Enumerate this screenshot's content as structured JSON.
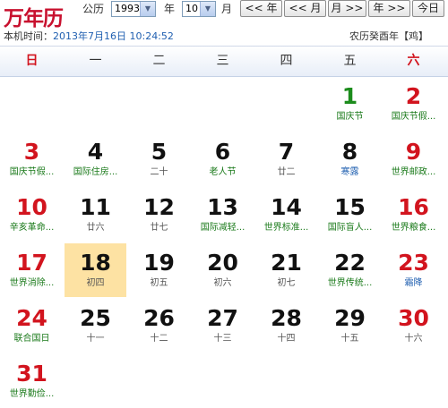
{
  "header": {
    "logo": "万年历",
    "gregorian_label": "公历",
    "year": "1993",
    "year_label": "年",
    "month": "10",
    "month_label": "月",
    "buttons": {
      "prev_year": "<< 年",
      "prev_month": "<< 月",
      "next_month": "月 >>",
      "next_year": "年 >>",
      "today": "今日"
    },
    "local_time_label": "本机时间：",
    "local_time": "2013年7月16日 10:24:52",
    "lunar_year": "农历癸酉年【鸡】"
  },
  "weekdays": [
    "日",
    "一",
    "二",
    "三",
    "四",
    "五",
    "六"
  ],
  "colors": {
    "red": "#d2141e",
    "green": "#1c8c1c",
    "blue": "#1f5fb0",
    "today_bg": "#fde2a3"
  },
  "days": [
    {
      "day": "1",
      "sub": "国庆节",
      "col": 5,
      "row": 0,
      "dc": "green",
      "sc": "green"
    },
    {
      "day": "2",
      "sub": "国庆节假...",
      "col": 6,
      "row": 0,
      "dc": "red",
      "sc": "green"
    },
    {
      "day": "3",
      "sub": "国庆节假...",
      "col": 0,
      "row": 1,
      "dc": "red",
      "sc": "green"
    },
    {
      "day": "4",
      "sub": "国际住房...",
      "col": 1,
      "row": 1,
      "dc": "",
      "sc": "green"
    },
    {
      "day": "5",
      "sub": "二十",
      "col": 2,
      "row": 1,
      "dc": "",
      "sc": ""
    },
    {
      "day": "6",
      "sub": "老人节",
      "col": 3,
      "row": 1,
      "dc": "",
      "sc": "green"
    },
    {
      "day": "7",
      "sub": "廿二",
      "col": 4,
      "row": 1,
      "dc": "",
      "sc": ""
    },
    {
      "day": "8",
      "sub": "寒露",
      "col": 5,
      "row": 1,
      "dc": "",
      "sc": "blue"
    },
    {
      "day": "9",
      "sub": "世界邮政...",
      "col": 6,
      "row": 1,
      "dc": "red",
      "sc": "green"
    },
    {
      "day": "10",
      "sub": "辛亥革命...",
      "col": 0,
      "row": 2,
      "dc": "red",
      "sc": "green"
    },
    {
      "day": "11",
      "sub": "廿六",
      "col": 1,
      "row": 2,
      "dc": "",
      "sc": ""
    },
    {
      "day": "12",
      "sub": "廿七",
      "col": 2,
      "row": 2,
      "dc": "",
      "sc": ""
    },
    {
      "day": "13",
      "sub": "国际减轻...",
      "col": 3,
      "row": 2,
      "dc": "",
      "sc": "green"
    },
    {
      "day": "14",
      "sub": "世界标准...",
      "col": 4,
      "row": 2,
      "dc": "",
      "sc": "green"
    },
    {
      "day": "15",
      "sub": "国际盲人...",
      "col": 5,
      "row": 2,
      "dc": "",
      "sc": "green"
    },
    {
      "day": "16",
      "sub": "世界粮食...",
      "col": 6,
      "row": 2,
      "dc": "red",
      "sc": "green"
    },
    {
      "day": "17",
      "sub": "世界消除...",
      "col": 0,
      "row": 3,
      "dc": "red",
      "sc": "green"
    },
    {
      "day": "18",
      "sub": "初四",
      "col": 1,
      "row": 3,
      "dc": "",
      "sc": "",
      "today": true
    },
    {
      "day": "19",
      "sub": "初五",
      "col": 2,
      "row": 3,
      "dc": "",
      "sc": ""
    },
    {
      "day": "20",
      "sub": "初六",
      "col": 3,
      "row": 3,
      "dc": "",
      "sc": ""
    },
    {
      "day": "21",
      "sub": "初七",
      "col": 4,
      "row": 3,
      "dc": "",
      "sc": ""
    },
    {
      "day": "22",
      "sub": "世界传统...",
      "col": 5,
      "row": 3,
      "dc": "",
      "sc": "green"
    },
    {
      "day": "23",
      "sub": "霜降",
      "col": 6,
      "row": 3,
      "dc": "red",
      "sc": "blue"
    },
    {
      "day": "24",
      "sub": "联合国日",
      "col": 0,
      "row": 4,
      "dc": "red",
      "sc": "green"
    },
    {
      "day": "25",
      "sub": "十一",
      "col": 1,
      "row": 4,
      "dc": "",
      "sc": ""
    },
    {
      "day": "26",
      "sub": "十二",
      "col": 2,
      "row": 4,
      "dc": "",
      "sc": ""
    },
    {
      "day": "27",
      "sub": "十三",
      "col": 3,
      "row": 4,
      "dc": "",
      "sc": ""
    },
    {
      "day": "28",
      "sub": "十四",
      "col": 4,
      "row": 4,
      "dc": "",
      "sc": ""
    },
    {
      "day": "29",
      "sub": "十五",
      "col": 5,
      "row": 4,
      "dc": "",
      "sc": ""
    },
    {
      "day": "30",
      "sub": "十六",
      "col": 6,
      "row": 4,
      "dc": "red",
      "sc": ""
    },
    {
      "day": "31",
      "sub": "世界勤俭...",
      "col": 0,
      "row": 5,
      "dc": "red",
      "sc": "green"
    }
  ]
}
